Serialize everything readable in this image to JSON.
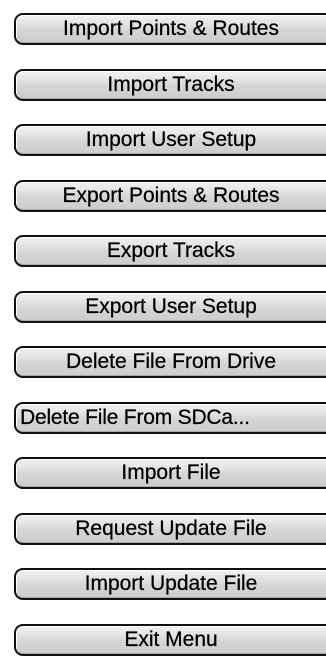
{
  "menu": {
    "items": [
      {
        "label": "Import Points & Routes"
      },
      {
        "label": "Import Tracks"
      },
      {
        "label": "Import User Setup"
      },
      {
        "label": "Export Points & Routes"
      },
      {
        "label": "Export Tracks"
      },
      {
        "label": "Export User Setup"
      },
      {
        "label": "Delete File From Drive"
      },
      {
        "label": "Delete File From SDCa..."
      },
      {
        "label": "Import File"
      },
      {
        "label": "Request Update File"
      },
      {
        "label": "Import Update File"
      },
      {
        "label": "Exit Menu"
      }
    ]
  }
}
